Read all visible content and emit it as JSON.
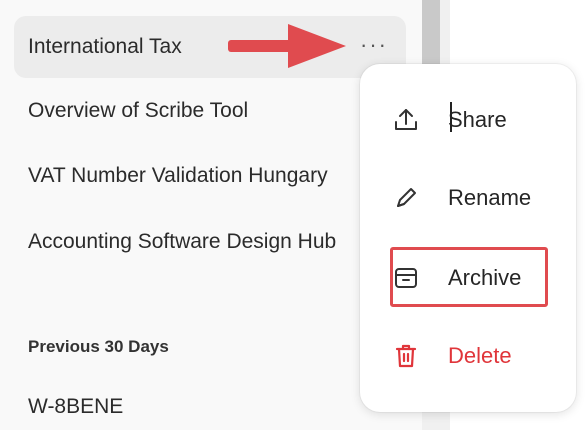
{
  "sidebar": {
    "conversations": [
      {
        "label": "International Tax",
        "active": true
      },
      {
        "label": "Overview of Scribe Tool"
      },
      {
        "label": "VAT Number Validation Hungary"
      },
      {
        "label": "Accounting Software Design Hub"
      }
    ],
    "section_heading": "Previous 30 Days",
    "older_conversations": [
      {
        "label": "W-8BENE"
      }
    ],
    "more_button": "···"
  },
  "context_menu": {
    "items": [
      {
        "label": "Share",
        "icon": "share-icon"
      },
      {
        "label": "Rename",
        "icon": "pencil-icon"
      },
      {
        "label": "Archive",
        "icon": "archive-icon"
      },
      {
        "label": "Delete",
        "icon": "trash-icon"
      }
    ]
  },
  "colors": {
    "accent_red": "#e0353a",
    "annotation_red": "#e04b4f",
    "active_bg": "#ececec"
  }
}
